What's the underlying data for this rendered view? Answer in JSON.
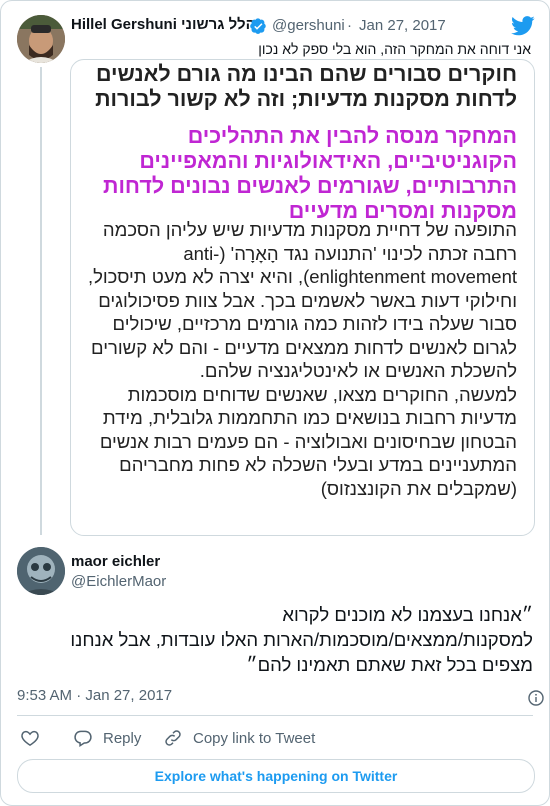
{
  "colors": {
    "accent": "#1d9bf0",
    "text": "#0f1419",
    "secondary": "#536471",
    "border": "#cfd9de",
    "headline_magenta": "#c026d3"
  },
  "quoted_tweet": {
    "author_name": "Hillel Gershuni הלל גרשוני",
    "verified_icon": "verified-badge-icon",
    "handle": "@gershuni",
    "dot": "·",
    "date": "Jan 27, 2017",
    "text": "אני דוחה את המחקר הזה, הוא בלי ספק לא נכון",
    "media": {
      "headline": "חוקרים סבורים שהם הבינו מה גורם לאנשים לדחות מסקנות מדעיות; וזה לא קשור לבורות",
      "subheadline": "המחקר מנסה להבין את התהליכים הקוגניטיביים, האידאולוגיות והמאפיינים התרבותיים, שגורמים לאנשים נבונים לדחות מסקנות ומסרים מדעיים",
      "body_p1": "התופעה של דחיית מסקנות מדעיות שיש עליהן הסכמה רחבה זכתה לכינוי 'התנועה נגד הָאָרָה' (anti-enlightenment movement), והיא יצרה לא מעט תיסכול, וחילוקי דעות באשר לאשמים בכך. אבל צוות פסיכולוגים סבור שעלה בידו לזהות כמה גורמים מרכזיים, שיכולים לגרום לאנשים לדחות ממצאים מדעיים - והם לא קשורים להשכלת האנשים או לאינטליגנציה שלהם.",
      "body_p2": "למעשה, החוקרים מצאו, שאנשים שדוחים מוסכמות מדעיות רחבות בנושאים כמו התחממות גלובלית, מידת הבטחון שבחיסונים ואבולוציה - הם פעמים רבות אנשים המתעניינים במדע ובעלי השכלה לא פחות מחבריהם (שמקבלים את הקונצנזוס)"
    }
  },
  "reply_tweet": {
    "author_name": "maor eichler",
    "handle": "@EichlerMaor",
    "text": "״אנחנו בעצמנו לא מוכנים לקרוא למסקנות/ממצאים/מוסכמות/הארות האלו עובדות, אבל אנחנו מצפים בכל זאת שאתם תאמינו להם״",
    "time": "9:53 AM · Jan 27, 2017"
  },
  "actions": {
    "like_icon": "heart-icon",
    "reply_label": "Reply",
    "copy_label": "Copy link to Tweet"
  },
  "explore_label": "Explore what's happening on Twitter"
}
